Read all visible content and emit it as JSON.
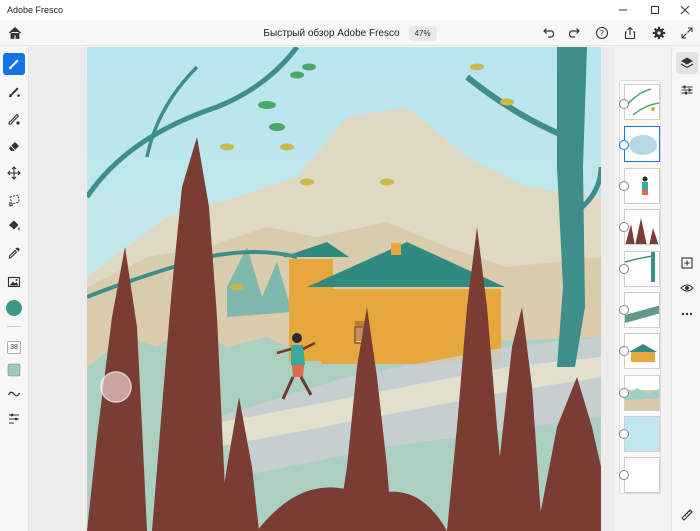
{
  "window": {
    "app_name": "Adobe Fresco"
  },
  "header": {
    "document_title": "Быстрый обзор Adobe Fresco",
    "zoom": "47%"
  },
  "tools": {
    "brush_size": "38"
  },
  "colors": {
    "accent": "#1473e6",
    "current_color": "#3a9a8a",
    "secondary_swatch": "#9cc8c4"
  },
  "layers": {
    "count": 10,
    "selected_index": 1
  }
}
